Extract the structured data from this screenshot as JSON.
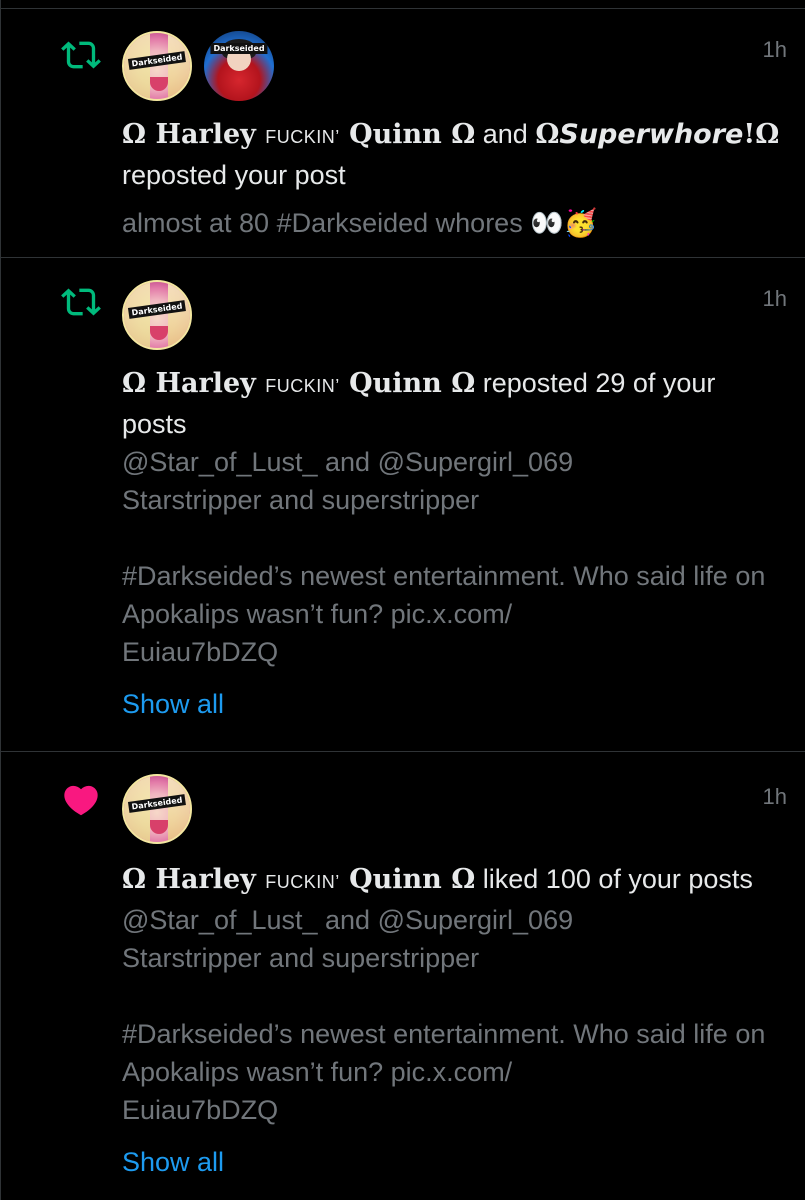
{
  "colors": {
    "background": "#000000",
    "divider": "#2f3336",
    "text_primary": "#e7e9ea",
    "text_muted": "#71767b",
    "repost_green": "#00ba7c",
    "like_pink": "#f91880",
    "link_blue": "#1d9bf0"
  },
  "notifications": [
    {
      "type_icon": "repost-icon",
      "timestamp": "1h",
      "avatars": [
        {
          "label": "Darkseided"
        },
        {
          "label": "Darkseided"
        }
      ],
      "actor1": {
        "omega_open": "Ω",
        "first": "Harley",
        "middle": "FUCKIN’",
        "last": "Quinn",
        "omega_close": "Ω"
      },
      "joiner": "and",
      "actor2": {
        "omega_open": "Ω",
        "name": "Superwhore",
        "bang": "!",
        "omega_close": "Ω"
      },
      "action": "reposted your post",
      "preview": "almost at 80 #Darkseided whores",
      "preview_emoji": "👀🥳"
    },
    {
      "type_icon": "repost-icon",
      "timestamp": "1h",
      "avatars": [
        {
          "label": "Darkseided"
        }
      ],
      "actor1": {
        "omega_open": "Ω",
        "first": "Harley",
        "middle": "FUCKIN’",
        "last": "Quinn",
        "omega_close": "Ω"
      },
      "action": "reposted 29 of your posts",
      "preview": "@Star_of_Lust_ and @Supergirl_069\nStarstripper and superstripper\n\n#Darkseided’s newest entertainment.  Who said life on Apokalips wasn’t fun? pic.x.com/\nEuiau7bDZQ",
      "show_all": "Show all"
    },
    {
      "type_icon": "heart-icon",
      "timestamp": "1h",
      "avatars": [
        {
          "label": "Darkseided"
        }
      ],
      "actor1": {
        "omega_open": "Ω",
        "first": "Harley",
        "middle": "FUCKIN’",
        "last": "Quinn",
        "omega_close": "Ω"
      },
      "action": "liked 100 of your posts",
      "preview": "@Star_of_Lust_ and @Supergirl_069\nStarstripper and superstripper\n\n#Darkseided’s newest entertainment.  Who said life on Apokalips wasn’t fun? pic.x.com/\nEuiau7bDZQ",
      "show_all": "Show all"
    }
  ]
}
